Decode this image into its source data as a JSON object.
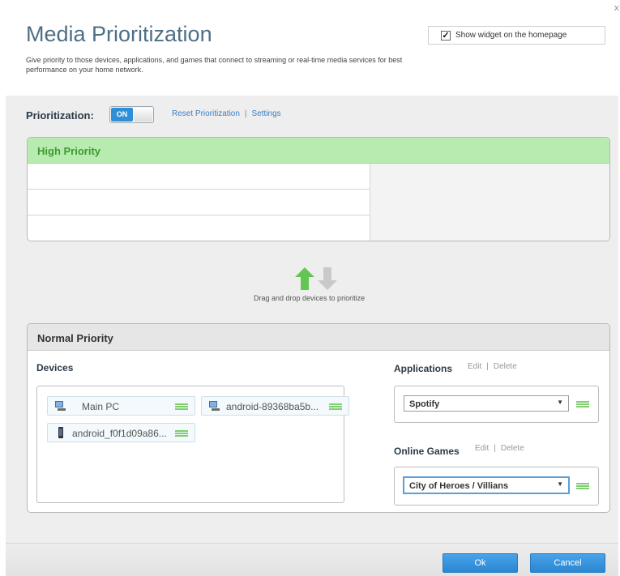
{
  "header": {
    "title": "Media Prioritization",
    "subtitle": "Give priority to those devices, applications, and games that connect to streaming or real-time media services for best performance on your home network.",
    "show_widget_label": "Show widget on the homepage",
    "show_widget_checked": true,
    "close_glyph": "x"
  },
  "prioritization": {
    "label": "Prioritization:",
    "toggle_state": "ON",
    "reset_link": "Reset Prioritization",
    "separator": "|",
    "settings_link": "Settings"
  },
  "high_priority": {
    "title": "High Priority",
    "slots": [
      "",
      "",
      ""
    ]
  },
  "drag_hint": "Drag and drop devices to prioritize",
  "normal_priority": {
    "title": "Normal Priority",
    "devices_label": "Devices",
    "devices": [
      {
        "name": "Main PC",
        "icon": "desktop-icon"
      },
      {
        "name": "android-89368ba5b...",
        "icon": "desktop-icon"
      },
      {
        "name": "android_f0f1d09a86...",
        "icon": "phone-icon"
      }
    ],
    "applications": {
      "label": "Applications",
      "edit": "Edit",
      "separator": "|",
      "delete": "Delete",
      "selected": "Spotify"
    },
    "online_games": {
      "label": "Online Games",
      "edit": "Edit",
      "separator": "|",
      "delete": "Delete",
      "selected": "City of Heroes / Villians"
    }
  },
  "footer": {
    "ok": "Ok",
    "cancel": "Cancel"
  },
  "colors": {
    "accent_blue": "#2e8fd6",
    "high_priority_bg": "#b8ebb0",
    "high_priority_text": "#3c9b2e",
    "grip_green": "#7fcf6f"
  }
}
